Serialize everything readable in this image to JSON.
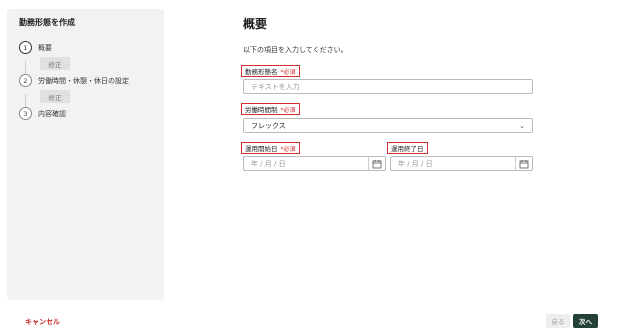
{
  "sidebar": {
    "title": "勤務形態を作成",
    "steps": [
      {
        "num": "1",
        "label": "概要",
        "edit": "修正"
      },
      {
        "num": "2",
        "label": "労働時間・休憩・休日の設定",
        "edit": "修正"
      },
      {
        "num": "3",
        "label": "内容確認"
      }
    ],
    "cancel_label": "キャンセル"
  },
  "main": {
    "title": "概要",
    "intro": "以下の項目を入力してください。",
    "fields": {
      "name": {
        "label": "勤務形態名",
        "required": "*必須",
        "placeholder": "テキストを入力"
      },
      "working_hours_system": {
        "label": "労働時間制",
        "required": "*必須",
        "value": "フレックス"
      },
      "start_date": {
        "label": "運用開始日",
        "required": "*必須",
        "placeholder": "年 / 月 / 日"
      },
      "end_date": {
        "label": "運用終了日",
        "placeholder": "年 / 月 / 日"
      }
    }
  },
  "footer": {
    "back_label": "戻る",
    "next_label": "次へ"
  },
  "colors": {
    "accent": "#234138",
    "required": "#d32f2f",
    "cancel": "#c62828"
  }
}
